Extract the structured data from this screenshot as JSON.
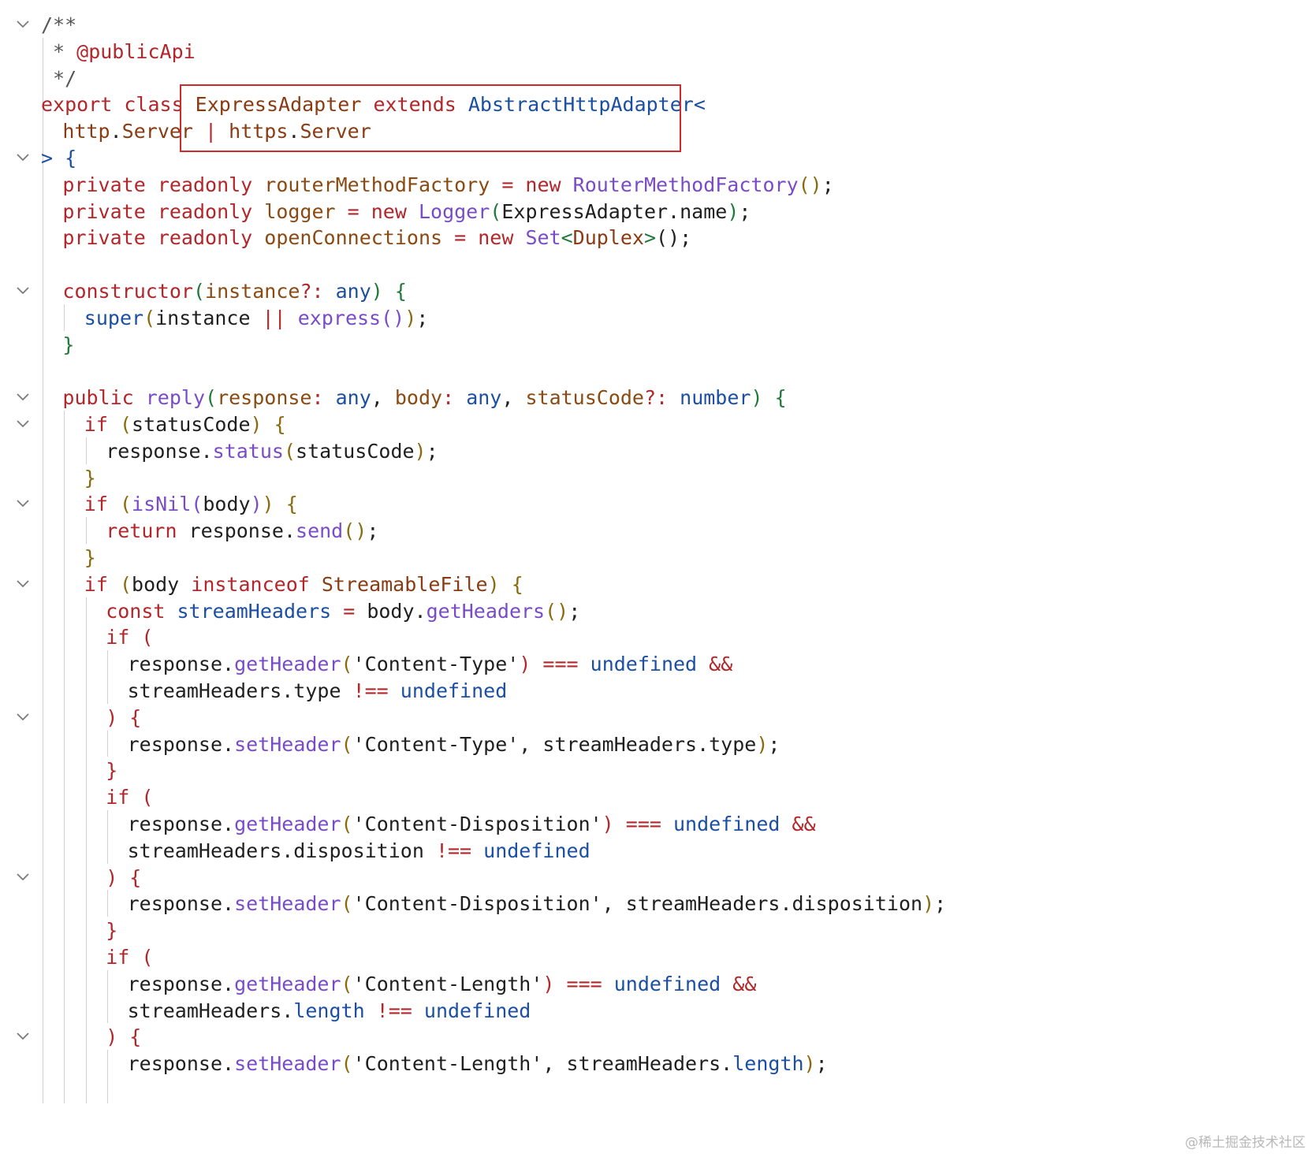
{
  "colors": {
    "default": "#1f1f1f",
    "keyword": "#b3262a",
    "class_name": "#8a3b12",
    "type_blue": "#1a4fa3",
    "function_purple": "#7a4bc9",
    "param_brown": "#8a4a12",
    "punct_brown": "#8a6a0d",
    "bracket_green": "#1f7a3a",
    "comment": "#555555",
    "highlight_box": "#cc2b2b"
  },
  "editor": {
    "fold_icon": "chevron-down-icon",
    "highlight_note": "ExpressAdapter extends AbstractHttpAdapter< http.Server | https.Server",
    "lines": [
      {
        "fold": true,
        "indent": 0,
        "tokens": [
          {
            "t": "/**",
            "c": "comment"
          }
        ]
      },
      {
        "fold": false,
        "indent": 0,
        "tokens": [
          {
            "t": " * ",
            "c": "comment"
          },
          {
            "t": "@publicApi",
            "c": "keyword"
          }
        ]
      },
      {
        "fold": false,
        "indent": 0,
        "tokens": [
          {
            "t": " */",
            "c": "comment"
          }
        ]
      },
      {
        "fold": false,
        "indent": 0,
        "tokens": [
          {
            "t": "export ",
            "c": "keyword"
          },
          {
            "t": "class ",
            "c": "keyword"
          },
          {
            "t": "ExpressAdapter",
            "c": "class_name"
          },
          {
            "t": " extends ",
            "c": "keyword"
          },
          {
            "t": "AbstractHttpAdapter",
            "c": "type_blue"
          },
          {
            "t": "<",
            "c": "type_blue"
          }
        ]
      },
      {
        "fold": false,
        "indent": 1,
        "tokens": [
          {
            "t": "http",
            "c": "class_name"
          },
          {
            "t": ".",
            "c": "default"
          },
          {
            "t": "Server",
            "c": "class_name"
          },
          {
            "t": " | ",
            "c": "keyword"
          },
          {
            "t": "https",
            "c": "class_name"
          },
          {
            "t": ".",
            "c": "default"
          },
          {
            "t": "Server",
            "c": "class_name"
          }
        ]
      },
      {
        "fold": true,
        "indent": 0,
        "tokens": [
          {
            "t": "> ",
            "c": "type_blue"
          },
          {
            "t": "{",
            "c": "type_blue"
          }
        ]
      },
      {
        "fold": false,
        "indent": 1,
        "tokens": [
          {
            "t": "private ",
            "c": "keyword"
          },
          {
            "t": "readonly ",
            "c": "keyword"
          },
          {
            "t": "routerMethodFactory",
            "c": "param_brown"
          },
          {
            "t": " = ",
            "c": "keyword"
          },
          {
            "t": "new ",
            "c": "keyword"
          },
          {
            "t": "RouterMethodFactory",
            "c": "function_purple"
          },
          {
            "t": "()",
            "c": "punct_brown"
          },
          {
            "t": ";",
            "c": "default"
          }
        ]
      },
      {
        "fold": false,
        "indent": 1,
        "tokens": [
          {
            "t": "private ",
            "c": "keyword"
          },
          {
            "t": "readonly ",
            "c": "keyword"
          },
          {
            "t": "logger",
            "c": "param_brown"
          },
          {
            "t": " = ",
            "c": "keyword"
          },
          {
            "t": "new ",
            "c": "keyword"
          },
          {
            "t": "Logger",
            "c": "function_purple"
          },
          {
            "t": "(",
            "c": "bracket_green"
          },
          {
            "t": "ExpressAdapter.name",
            "c": "default"
          },
          {
            "t": ")",
            "c": "bracket_green"
          },
          {
            "t": ";",
            "c": "default"
          }
        ]
      },
      {
        "fold": false,
        "indent": 1,
        "tokens": [
          {
            "t": "private ",
            "c": "keyword"
          },
          {
            "t": "readonly ",
            "c": "keyword"
          },
          {
            "t": "openConnections",
            "c": "param_brown"
          },
          {
            "t": " = ",
            "c": "keyword"
          },
          {
            "t": "new ",
            "c": "keyword"
          },
          {
            "t": "Set",
            "c": "function_purple"
          },
          {
            "t": "<",
            "c": "bracket_green"
          },
          {
            "t": "Duplex",
            "c": "class_name"
          },
          {
            "t": ">",
            "c": "bracket_green"
          },
          {
            "t": "()",
            "c": "default"
          },
          {
            "t": ";",
            "c": "default"
          }
        ]
      },
      {
        "fold": false,
        "indent": 0,
        "tokens": []
      },
      {
        "fold": true,
        "indent": 1,
        "tokens": [
          {
            "t": "constructor",
            "c": "keyword"
          },
          {
            "t": "(",
            "c": "bracket_green"
          },
          {
            "t": "instance",
            "c": "param_brown"
          },
          {
            "t": "?: ",
            "c": "keyword"
          },
          {
            "t": "any",
            "c": "type_blue"
          },
          {
            "t": ") ",
            "c": "bracket_green"
          },
          {
            "t": "{",
            "c": "bracket_green"
          }
        ]
      },
      {
        "fold": false,
        "indent": 2,
        "tokens": [
          {
            "t": "super",
            "c": "type_blue"
          },
          {
            "t": "(",
            "c": "punct_brown"
          },
          {
            "t": "instance ",
            "c": "default"
          },
          {
            "t": "|| ",
            "c": "keyword"
          },
          {
            "t": "express",
            "c": "function_purple"
          },
          {
            "t": "()",
            "c": "function_purple"
          },
          {
            "t": ")",
            "c": "punct_brown"
          },
          {
            "t": ";",
            "c": "default"
          }
        ]
      },
      {
        "fold": false,
        "indent": 1,
        "tokens": [
          {
            "t": "}",
            "c": "bracket_green"
          }
        ]
      },
      {
        "fold": false,
        "indent": 0,
        "tokens": []
      },
      {
        "fold": true,
        "indent": 1,
        "tokens": [
          {
            "t": "public ",
            "c": "keyword"
          },
          {
            "t": "reply",
            "c": "function_purple"
          },
          {
            "t": "(",
            "c": "bracket_green"
          },
          {
            "t": "response",
            "c": "param_brown"
          },
          {
            "t": ": ",
            "c": "keyword"
          },
          {
            "t": "any",
            "c": "type_blue"
          },
          {
            "t": ", ",
            "c": "default"
          },
          {
            "t": "body",
            "c": "param_brown"
          },
          {
            "t": ": ",
            "c": "keyword"
          },
          {
            "t": "any",
            "c": "type_blue"
          },
          {
            "t": ", ",
            "c": "default"
          },
          {
            "t": "statusCode",
            "c": "param_brown"
          },
          {
            "t": "?: ",
            "c": "keyword"
          },
          {
            "t": "number",
            "c": "type_blue"
          },
          {
            "t": ") ",
            "c": "bracket_green"
          },
          {
            "t": "{",
            "c": "bracket_green"
          }
        ]
      },
      {
        "fold": true,
        "indent": 2,
        "tokens": [
          {
            "t": "if ",
            "c": "keyword"
          },
          {
            "t": "(",
            "c": "punct_brown"
          },
          {
            "t": "statusCode",
            "c": "default"
          },
          {
            "t": ") ",
            "c": "punct_brown"
          },
          {
            "t": "{",
            "c": "punct_brown"
          }
        ]
      },
      {
        "fold": false,
        "indent": 3,
        "tokens": [
          {
            "t": "response.",
            "c": "default"
          },
          {
            "t": "status",
            "c": "function_purple"
          },
          {
            "t": "(",
            "c": "punct_brown"
          },
          {
            "t": "statusCode",
            "c": "default"
          },
          {
            "t": ")",
            "c": "punct_brown"
          },
          {
            "t": ";",
            "c": "default"
          }
        ]
      },
      {
        "fold": false,
        "indent": 2,
        "tokens": [
          {
            "t": "}",
            "c": "punct_brown"
          }
        ]
      },
      {
        "fold": true,
        "indent": 2,
        "tokens": [
          {
            "t": "if ",
            "c": "keyword"
          },
          {
            "t": "(",
            "c": "punct_brown"
          },
          {
            "t": "isNil",
            "c": "function_purple"
          },
          {
            "t": "(",
            "c": "function_purple"
          },
          {
            "t": "body",
            "c": "default"
          },
          {
            "t": ")",
            "c": "function_purple"
          },
          {
            "t": ") ",
            "c": "punct_brown"
          },
          {
            "t": "{",
            "c": "punct_brown"
          }
        ]
      },
      {
        "fold": false,
        "indent": 3,
        "tokens": [
          {
            "t": "return ",
            "c": "keyword"
          },
          {
            "t": "response.",
            "c": "default"
          },
          {
            "t": "send",
            "c": "function_purple"
          },
          {
            "t": "()",
            "c": "punct_brown"
          },
          {
            "t": ";",
            "c": "default"
          }
        ]
      },
      {
        "fold": false,
        "indent": 2,
        "tokens": [
          {
            "t": "}",
            "c": "punct_brown"
          }
        ]
      },
      {
        "fold": true,
        "indent": 2,
        "tokens": [
          {
            "t": "if ",
            "c": "keyword"
          },
          {
            "t": "(",
            "c": "punct_brown"
          },
          {
            "t": "body ",
            "c": "default"
          },
          {
            "t": "instanceof ",
            "c": "keyword"
          },
          {
            "t": "StreamableFile",
            "c": "class_name"
          },
          {
            "t": ") ",
            "c": "punct_brown"
          },
          {
            "t": "{",
            "c": "punct_brown"
          }
        ]
      },
      {
        "fold": false,
        "indent": 3,
        "tokens": [
          {
            "t": "const ",
            "c": "keyword"
          },
          {
            "t": "streamHeaders",
            "c": "type_blue"
          },
          {
            "t": " = ",
            "c": "keyword"
          },
          {
            "t": "body.",
            "c": "default"
          },
          {
            "t": "getHeaders",
            "c": "function_purple"
          },
          {
            "t": "()",
            "c": "punct_brown"
          },
          {
            "t": ";",
            "c": "default"
          }
        ]
      },
      {
        "fold": false,
        "indent": 3,
        "tokens": [
          {
            "t": "if ",
            "c": "keyword"
          },
          {
            "t": "(",
            "c": "keyword"
          }
        ]
      },
      {
        "fold": false,
        "indent": 4,
        "tokens": [
          {
            "t": "response.",
            "c": "default"
          },
          {
            "t": "getHeader",
            "c": "function_purple"
          },
          {
            "t": "(",
            "c": "punct_brown"
          },
          {
            "t": "'Content-Type'",
            "c": "default"
          },
          {
            "t": ")",
            "c": "keyword"
          },
          {
            "t": " === ",
            "c": "keyword"
          },
          {
            "t": "undefined",
            "c": "type_blue"
          },
          {
            "t": " &&",
            "c": "keyword"
          }
        ]
      },
      {
        "fold": false,
        "indent": 4,
        "tokens": [
          {
            "t": "streamHeaders.type ",
            "c": "default"
          },
          {
            "t": "!== ",
            "c": "keyword"
          },
          {
            "t": "undefined",
            "c": "type_blue"
          }
        ]
      },
      {
        "fold": true,
        "indent": 3,
        "tokens": [
          {
            "t": ") ",
            "c": "keyword"
          },
          {
            "t": "{",
            "c": "keyword"
          }
        ]
      },
      {
        "fold": false,
        "indent": 4,
        "tokens": [
          {
            "t": "response.",
            "c": "default"
          },
          {
            "t": "setHeader",
            "c": "function_purple"
          },
          {
            "t": "(",
            "c": "punct_brown"
          },
          {
            "t": "'Content-Type', streamHeaders.type",
            "c": "default"
          },
          {
            "t": ")",
            "c": "punct_brown"
          },
          {
            "t": ";",
            "c": "default"
          }
        ]
      },
      {
        "fold": false,
        "indent": 3,
        "tokens": [
          {
            "t": "}",
            "c": "keyword"
          }
        ]
      },
      {
        "fold": false,
        "indent": 3,
        "tokens": [
          {
            "t": "if ",
            "c": "keyword"
          },
          {
            "t": "(",
            "c": "keyword"
          }
        ]
      },
      {
        "fold": false,
        "indent": 4,
        "tokens": [
          {
            "t": "response.",
            "c": "default"
          },
          {
            "t": "getHeader",
            "c": "function_purple"
          },
          {
            "t": "(",
            "c": "punct_brown"
          },
          {
            "t": "'Content-Disposition'",
            "c": "default"
          },
          {
            "t": ")",
            "c": "keyword"
          },
          {
            "t": " === ",
            "c": "keyword"
          },
          {
            "t": "undefined",
            "c": "type_blue"
          },
          {
            "t": " &&",
            "c": "keyword"
          }
        ]
      },
      {
        "fold": false,
        "indent": 4,
        "tokens": [
          {
            "t": "streamHeaders.disposition ",
            "c": "default"
          },
          {
            "t": "!== ",
            "c": "keyword"
          },
          {
            "t": "undefined",
            "c": "type_blue"
          }
        ]
      },
      {
        "fold": true,
        "indent": 3,
        "tokens": [
          {
            "t": ") ",
            "c": "keyword"
          },
          {
            "t": "{",
            "c": "keyword"
          }
        ]
      },
      {
        "fold": false,
        "indent": 4,
        "tokens": [
          {
            "t": "response.",
            "c": "default"
          },
          {
            "t": "setHeader",
            "c": "function_purple"
          },
          {
            "t": "(",
            "c": "punct_brown"
          },
          {
            "t": "'Content-Disposition', streamHeaders.disposition",
            "c": "default"
          },
          {
            "t": ")",
            "c": "punct_brown"
          },
          {
            "t": ";",
            "c": "default"
          }
        ]
      },
      {
        "fold": false,
        "indent": 3,
        "tokens": [
          {
            "t": "}",
            "c": "keyword"
          }
        ]
      },
      {
        "fold": false,
        "indent": 3,
        "tokens": [
          {
            "t": "if ",
            "c": "keyword"
          },
          {
            "t": "(",
            "c": "keyword"
          }
        ]
      },
      {
        "fold": false,
        "indent": 4,
        "tokens": [
          {
            "t": "response.",
            "c": "default"
          },
          {
            "t": "getHeader",
            "c": "function_purple"
          },
          {
            "t": "(",
            "c": "punct_brown"
          },
          {
            "t": "'Content-Length'",
            "c": "default"
          },
          {
            "t": ")",
            "c": "keyword"
          },
          {
            "t": " === ",
            "c": "keyword"
          },
          {
            "t": "undefined",
            "c": "type_blue"
          },
          {
            "t": " &&",
            "c": "keyword"
          }
        ]
      },
      {
        "fold": false,
        "indent": 4,
        "tokens": [
          {
            "t": "streamHeaders.",
            "c": "default"
          },
          {
            "t": "length",
            "c": "type_blue"
          },
          {
            "t": " !== ",
            "c": "keyword"
          },
          {
            "t": "undefined",
            "c": "type_blue"
          }
        ]
      },
      {
        "fold": true,
        "indent": 3,
        "tokens": [
          {
            "t": ") ",
            "c": "keyword"
          },
          {
            "t": "{",
            "c": "keyword"
          }
        ]
      },
      {
        "fold": false,
        "indent": 4,
        "tokens": [
          {
            "t": "response.",
            "c": "default"
          },
          {
            "t": "setHeader",
            "c": "function_purple"
          },
          {
            "t": "(",
            "c": "punct_brown"
          },
          {
            "t": "'Content-Length', streamHeaders.",
            "c": "default"
          },
          {
            "t": "length",
            "c": "type_blue"
          },
          {
            "t": ")",
            "c": "punct_brown"
          },
          {
            "t": ";",
            "c": "default"
          }
        ]
      }
    ]
  },
  "watermark": "@稀土掘金技术社区"
}
